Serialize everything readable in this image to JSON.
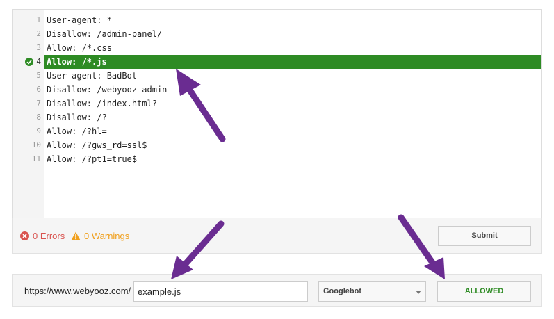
{
  "editor": {
    "lines": [
      {
        "num": "1",
        "text": "User-agent: *"
      },
      {
        "num": "2",
        "text": "Disallow: /admin-panel/"
      },
      {
        "num": "3",
        "text": "Allow: /*.css"
      },
      {
        "num": "4",
        "text": "Allow: /*.js"
      },
      {
        "num": "5",
        "text": "User-agent: BadBot"
      },
      {
        "num": "6",
        "text": "Disallow: /webyooz-admin"
      },
      {
        "num": "7",
        "text": "Disallow: /index.html?"
      },
      {
        "num": "8",
        "text": "Disallow: /?"
      },
      {
        "num": "9",
        "text": "Allow: /?hl="
      },
      {
        "num": "10",
        "text": "Allow: /?gws_rd=ssl$"
      },
      {
        "num": "11",
        "text": "Allow: /?pt1=true$"
      }
    ],
    "highlight_color": "#2e8b24"
  },
  "status": {
    "errors": "0 Errors",
    "warnings": "0 Warnings",
    "submit_label": "Submit"
  },
  "tester": {
    "base_url": "https://www.webyooz.com/",
    "path_value": "example.js",
    "user_agent": "Googlebot",
    "result": "ALLOWED",
    "result_color": "#2e8b24"
  },
  "annotations": {
    "arrow_color": "#6a2c91"
  }
}
